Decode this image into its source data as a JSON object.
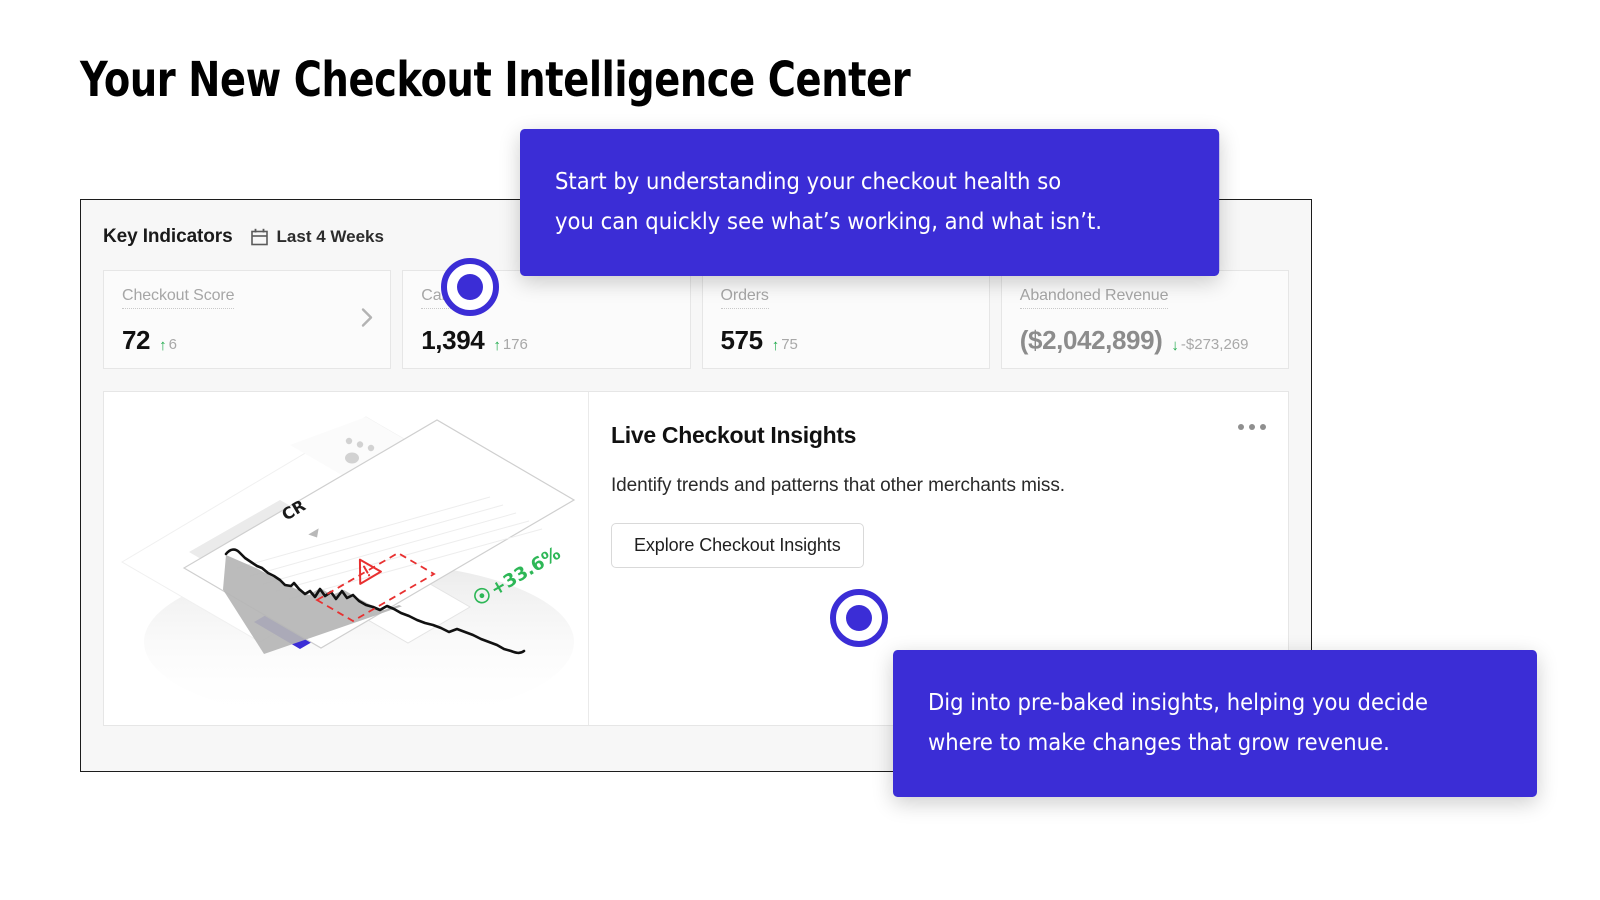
{
  "page": {
    "title": "Your New Checkout Intelligence Center"
  },
  "panel": {
    "title": "Key Indicators",
    "date_range": "Last 4 Weeks",
    "calendar_icon": "calendar-icon",
    "kpis": [
      {
        "label": "Checkout Score",
        "value": "72",
        "delta": "6",
        "direction": "up",
        "arrow": "↑",
        "has_chevron": true,
        "muted": false
      },
      {
        "label": "Carts",
        "value": "1,394",
        "delta": "176",
        "direction": "up",
        "arrow": "↑",
        "has_chevron": false,
        "muted": false
      },
      {
        "label": "Orders",
        "value": "575",
        "delta": "75",
        "direction": "up",
        "arrow": "↑",
        "has_chevron": false,
        "muted": false
      },
      {
        "label": "Abandoned Revenue",
        "value": "($2,042,899)",
        "delta": "-$273,269",
        "direction": "down",
        "arrow": "↓",
        "has_chevron": false,
        "muted": true
      }
    ]
  },
  "insights": {
    "title": "Live Checkout Insights",
    "description": "Identify trends and patterns that other merchants miss.",
    "button_label": "Explore Checkout Insights",
    "menu_icon": "kebab-menu-icon",
    "illustration": {
      "chart_label": "CR",
      "chart_dropdown_icon": "caret-down-icon",
      "badge_value": "+33.6%",
      "badge_icon": "target-icon",
      "alert_icon": "warning-triangle-icon"
    }
  },
  "tooltips": [
    {
      "id": "tooltip-1",
      "line1": "Start by understanding your checkout health so",
      "line2": "you can quickly see what’s working, and what isn’t."
    },
    {
      "id": "tooltip-2",
      "line1": "Dig into pre-baked insights, helping you decide",
      "line2": "where to make changes that grow revenue."
    }
  ],
  "markers": [
    {
      "id": "marker-1",
      "name": "step-marker-1"
    },
    {
      "id": "marker-2",
      "name": "step-marker-2"
    }
  ],
  "colors": {
    "accent_blue": "#3b2dd6",
    "positive_green": "#1faa4b",
    "panel_bg": "#f7f7f7",
    "border": "#1c1c1c"
  }
}
